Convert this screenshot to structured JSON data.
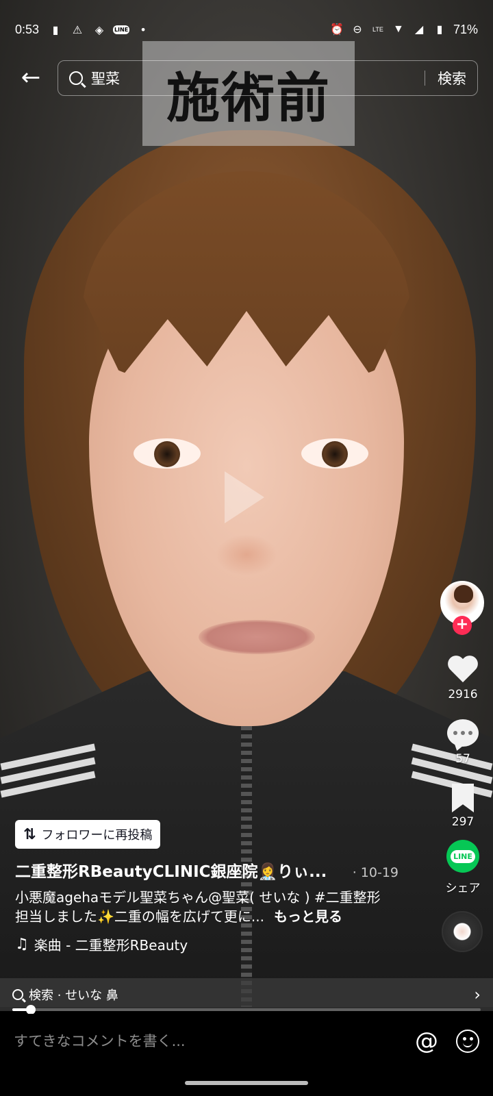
{
  "status_bar": {
    "time": "0:53",
    "battery": "71%",
    "left_icons": [
      "battery-saver-icon",
      "warning-icon",
      "app-notification-icon",
      "line-icon",
      "dot-icon"
    ],
    "right_icons": [
      "alarm-icon",
      "do-not-disturb-icon",
      "volte-icon",
      "wifi-icon",
      "signal-icon",
      "battery-icon"
    ],
    "line_badge": "LINE",
    "volte_label": "LTE"
  },
  "header": {
    "search_query": "聖菜",
    "search_button": "検索"
  },
  "video": {
    "overlay_label": "施術前"
  },
  "actions": {
    "like_count": "2916",
    "comment_count": "57",
    "bookmark_count": "297",
    "share_label": "シェア",
    "share_app": "LINE"
  },
  "post": {
    "repost_label": "フォロワーに再投稿",
    "author": "二重整形RBeautyCLINIC銀座院👩‍⚕️りぃ...",
    "date": "· 10-19",
    "caption": "小悪魔agehaモデル聖菜ちゃん@聖菜( せいな ) #二重整形 担当しました✨二重の幅を広げて更に...",
    "see_more": "もっと見る",
    "music": "楽曲 - 二重整形RBeauty"
  },
  "related_search": {
    "text": "検索 · せいな 鼻"
  },
  "playback": {
    "progress": 0.04
  },
  "comment_bar": {
    "placeholder": "すてきなコメントを書く..."
  },
  "colors": {
    "follow_badge": "#fe2c55",
    "line_green": "#06c755"
  }
}
